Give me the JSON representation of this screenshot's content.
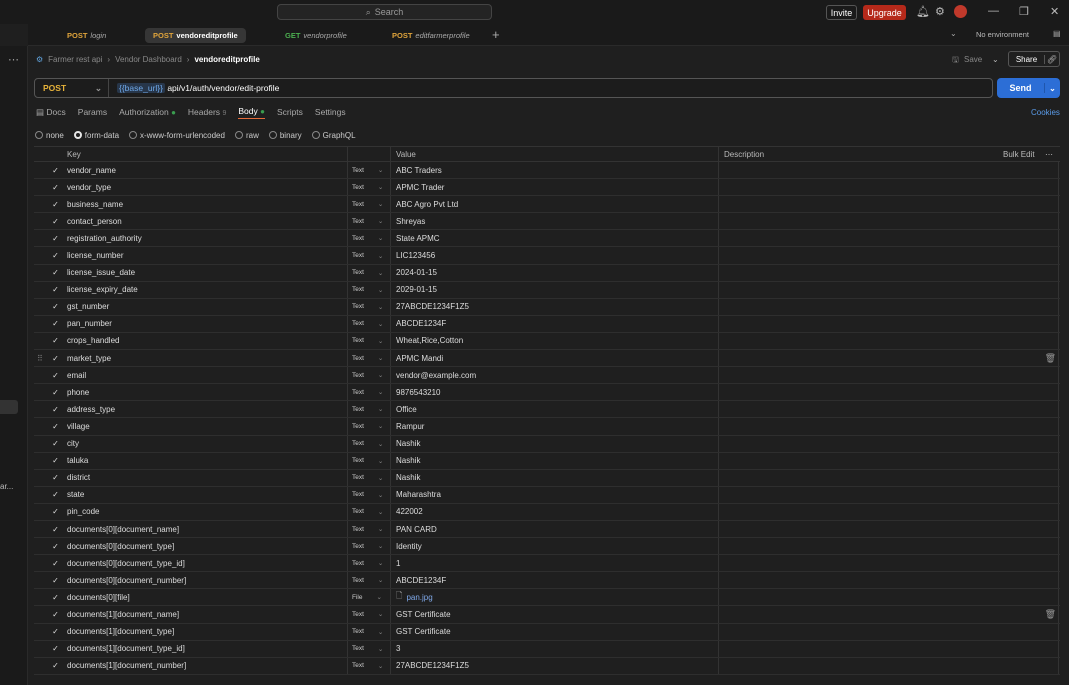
{
  "search": {
    "label": "Search"
  },
  "topbar": {
    "invite": "Invite",
    "upgrade": "Upgrade"
  },
  "tabs": [
    {
      "method": "POST",
      "name": "login"
    },
    {
      "method": "POST",
      "name": "vendoreditprofile"
    },
    {
      "method": "GET",
      "name": "vendorprofile"
    },
    {
      "method": "POST",
      "name": "editfarmerprofile"
    }
  ],
  "environment": "No environment",
  "breadcrumb": {
    "collection": "Farmer rest api",
    "folder": "Vendor Dashboard",
    "request": "vendoreditprofile"
  },
  "actions": {
    "save": "Save",
    "share": "Share"
  },
  "request": {
    "method": "POST",
    "url_var": "{{base_url}}",
    "url_path": " api/v1/auth/vendor/edit-profile",
    "send": "Send"
  },
  "req_tabs": {
    "docs": "Docs",
    "params": "Params",
    "authorization": "Authorization",
    "headers": "Headers",
    "headers_count": "9",
    "body": "Body",
    "scripts": "Scripts",
    "settings": "Settings",
    "cookies": "Cookies"
  },
  "body_types": [
    "none",
    "form-data",
    "x-www-form-urlencoded",
    "raw",
    "binary",
    "GraphQL"
  ],
  "columns": {
    "key": "Key",
    "value": "Value",
    "description": "Description",
    "bulk_edit": "Bulk Edit"
  },
  "rows": [
    {
      "key": "vendor_name",
      "type": "Text",
      "value": "ABC Traders"
    },
    {
      "key": "vendor_type",
      "type": "Text",
      "value": "APMC Trader"
    },
    {
      "key": "business_name",
      "type": "Text",
      "value": "ABC Agro Pvt Ltd"
    },
    {
      "key": "contact_person",
      "type": "Text",
      "value": "Shreyas"
    },
    {
      "key": "registration_authority",
      "type": "Text",
      "value": "State APMC"
    },
    {
      "key": "license_number",
      "type": "Text",
      "value": "LIC123456"
    },
    {
      "key": "license_issue_date",
      "type": "Text",
      "value": "2024-01-15"
    },
    {
      "key": "license_expiry_date",
      "type": "Text",
      "value": "2029-01-15"
    },
    {
      "key": "gst_number",
      "type": "Text",
      "value": "27ABCDE1234F1Z5"
    },
    {
      "key": "pan_number",
      "type": "Text",
      "value": "ABCDE1234F"
    },
    {
      "key": "crops_handled",
      "type": "Text",
      "value": "Wheat,Rice,Cotton"
    },
    {
      "key": "market_type",
      "type": "Text",
      "value": "APMC Mandi"
    },
    {
      "key": "email",
      "type": "Text",
      "value": "vendor@example.com"
    },
    {
      "key": "phone",
      "type": "Text",
      "value": "9876543210"
    },
    {
      "key": "address_type",
      "type": "Text",
      "value": "Office"
    },
    {
      "key": "village",
      "type": "Text",
      "value": "Rampur"
    },
    {
      "key": "city",
      "type": "Text",
      "value": "Nashik"
    },
    {
      "key": "taluka",
      "type": "Text",
      "value": "Nashik"
    },
    {
      "key": "district",
      "type": "Text",
      "value": "Nashik"
    },
    {
      "key": "state",
      "type": "Text",
      "value": "Maharashtra"
    },
    {
      "key": "pin_code",
      "type": "Text",
      "value": "422002"
    },
    {
      "key": "documents[0][document_name]",
      "type": "Text",
      "value": "PAN CARD"
    },
    {
      "key": "documents[0][document_type]",
      "type": "Text",
      "value": "Identity"
    },
    {
      "key": "documents[0][document_type_id]",
      "type": "Text",
      "value": "1"
    },
    {
      "key": "documents[0][document_number]",
      "type": "Text",
      "value": "ABCDE1234F"
    },
    {
      "key": "documents[0][file]",
      "type": "File",
      "value": "pan.jpg"
    },
    {
      "key": "documents[1][document_name]",
      "type": "Text",
      "value": "GST Certificate"
    },
    {
      "key": "documents[1][document_type]",
      "type": "Text",
      "value": "GST Certificate"
    },
    {
      "key": "documents[1][document_type_id]",
      "type": "Text",
      "value": "3"
    },
    {
      "key": "documents[1][document_number]",
      "type": "Text",
      "value": "27ABCDE1234F1Z5"
    }
  ],
  "left_rail_text": "ar..."
}
